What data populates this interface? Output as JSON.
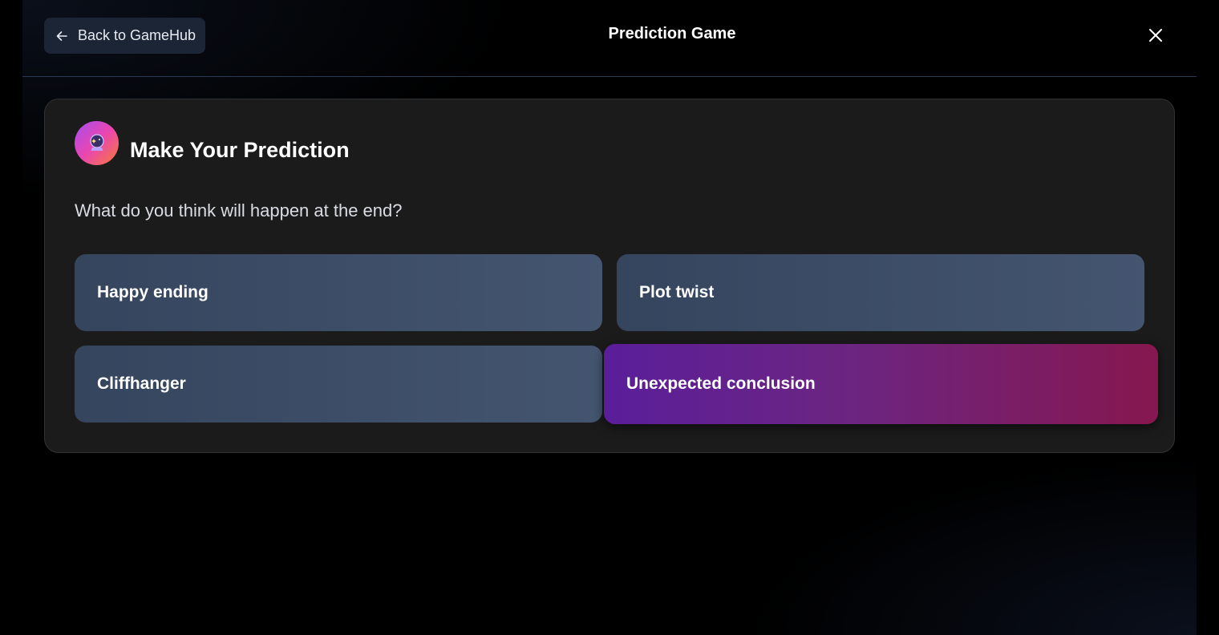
{
  "header": {
    "back_label": "Back to GameHub",
    "title": "Prediction Game"
  },
  "icons": {
    "back": "arrow-left-icon",
    "close": "close-icon",
    "prediction": "crystal-ball-icon"
  },
  "card": {
    "title": "Make Your Prediction",
    "question": "What do you think will happen at the end?",
    "options": [
      {
        "label": "Happy ending",
        "selected": false
      },
      {
        "label": "Plot twist",
        "selected": false
      },
      {
        "label": "Cliffhanger",
        "selected": false
      },
      {
        "label": "Unexpected conclusion",
        "selected": true
      }
    ]
  },
  "colors": {
    "background": "#000000",
    "card": "#1b1b1c",
    "option": "#3d4d66",
    "selected_start": "#5a1e9a",
    "selected_end": "#86174f"
  }
}
